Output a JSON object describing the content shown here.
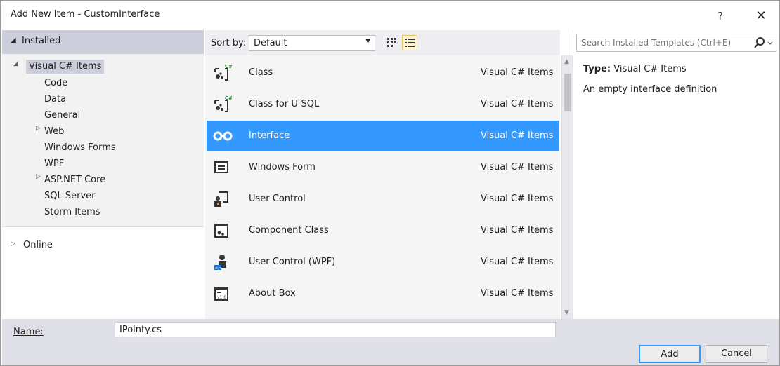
{
  "window": {
    "title": "Add New Item - CustomInterface",
    "help_label": "?",
    "close_label": "✕"
  },
  "tree": {
    "header": "Installed",
    "root": "Visual C# Items",
    "children": [
      "Code",
      "Data",
      "General",
      "Web",
      "Windows Forms",
      "WPF",
      "ASP.NET Core",
      "SQL Server",
      "Storm Items"
    ],
    "online": "Online"
  },
  "toolbar": {
    "sort_label": "Sort by:",
    "sort_value": "Default"
  },
  "templates": [
    {
      "name": "Class",
      "category": "Visual C# Items",
      "icon": "class-icon"
    },
    {
      "name": "Class for U-SQL",
      "category": "Visual C# Items",
      "icon": "class-icon"
    },
    {
      "name": "Interface",
      "category": "Visual C# Items",
      "icon": "interface-icon",
      "selected": true
    },
    {
      "name": "Windows Form",
      "category": "Visual C# Items",
      "icon": "windows-form-icon"
    },
    {
      "name": "User Control",
      "category": "Visual C# Items",
      "icon": "user-control-icon"
    },
    {
      "name": "Component Class",
      "category": "Visual C# Items",
      "icon": "component-class-icon"
    },
    {
      "name": "User Control (WPF)",
      "category": "Visual C# Items",
      "icon": "user-control-wpf-icon"
    },
    {
      "name": "About Box",
      "category": "Visual C# Items",
      "icon": "about-box-icon"
    }
  ],
  "search": {
    "placeholder": "Search Installed Templates (Ctrl+E)"
  },
  "details": {
    "type_label": "Type:",
    "type_value": "Visual C# Items",
    "description": "An empty interface definition"
  },
  "bottom": {
    "name_label": "Name:",
    "name_value": "IPointy.cs",
    "add_label": "Add",
    "cancel_label": "Cancel"
  },
  "colors": {
    "selection": "#3399ff",
    "tree_header": "#cccedb",
    "bottom_bar": "#dedfe7"
  }
}
